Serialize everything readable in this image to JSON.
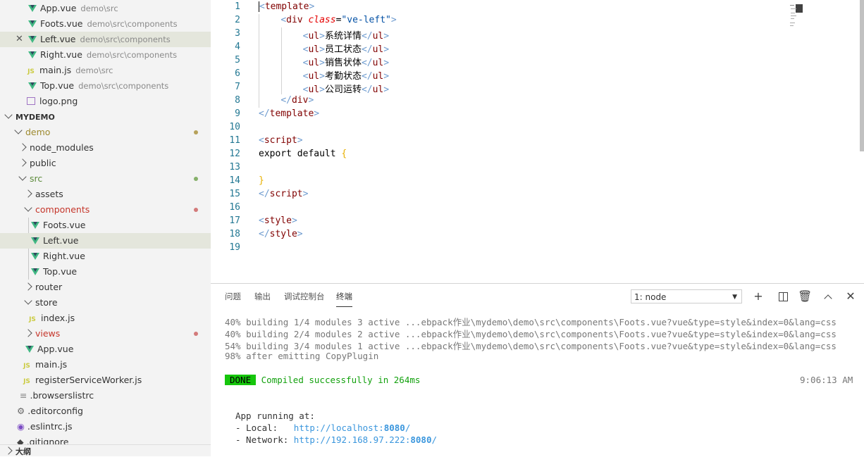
{
  "open_editors": [
    {
      "name": "App.vue",
      "path": "demo\\src",
      "type": "vue"
    },
    {
      "name": "Foots.vue",
      "path": "demo\\src\\components",
      "type": "vue"
    },
    {
      "name": "Left.vue",
      "path": "demo\\src\\components",
      "type": "vue",
      "selected": true
    },
    {
      "name": "Right.vue",
      "path": "demo\\src\\components",
      "type": "vue"
    },
    {
      "name": "main.js",
      "path": "demo\\src",
      "type": "js"
    },
    {
      "name": "Top.vue",
      "path": "demo\\src\\components",
      "type": "vue"
    },
    {
      "name": "logo.png",
      "path": "",
      "type": "img"
    }
  ],
  "explorer": {
    "section_title": "MYDEMO",
    "items": {
      "demo": "demo",
      "node_modules": "node_modules",
      "public": "public",
      "src": "src",
      "assets": "assets",
      "components": "components",
      "foots": "Foots.vue",
      "left": "Left.vue",
      "right": "Right.vue",
      "top": "Top.vue",
      "router": "router",
      "store": "store",
      "index": "index.js",
      "views": "views",
      "app": "App.vue",
      "main": "main.js",
      "rsw": "registerServiceWorker.js",
      "browserslist": ".browserslistrc",
      "editorconfig": ".editorconfig",
      "eslintrc": ".eslintrc.js",
      "gitignore": ".gitignore"
    },
    "outline_title": "大纲",
    "colors": {
      "modified": "#c5352a",
      "yellow_dot": "#b6a15a",
      "green_dot": "#86b06a"
    }
  },
  "editor": {
    "line_numbers": [
      "1",
      "2",
      "3",
      "4",
      "5",
      "6",
      "7",
      "8",
      "9",
      "10",
      "11",
      "12",
      "13",
      "14",
      "15",
      "16",
      "17",
      "18",
      "19"
    ],
    "items": [
      "系统详情",
      "员工状态",
      "销售状体",
      "考勤状态",
      "公司运转"
    ],
    "class_value": "\"ve-left\"",
    "export_text": "export default"
  },
  "panel": {
    "tabs": [
      "问题",
      "输出",
      "调试控制台",
      "终端"
    ],
    "active_tab": "终端",
    "terminal_select": "1: node",
    "log_lines": [
      "40% building 1/4 modules 3 active ...ebpack作业\\mydemo\\demo\\src\\components\\Foots.vue?vue&type=style&index=0&lang=css",
      "40% building 2/4 modules 2 active ...ebpack作业\\mydemo\\demo\\src\\components\\Foots.vue?vue&type=style&index=0&lang=css",
      "54% building 3/4 modules 1 active ...ebpack作业\\mydemo\\demo\\src\\components\\Foots.vue?vue&type=style&index=0&lang=css",
      "98% after emitting CopyPlugin"
    ],
    "done_badge": "DONE",
    "compiled_msg": "Compiled successfully in 264ms",
    "time": "9:06:13 AM",
    "app_running": "App running at:",
    "local_label": "- Local:   ",
    "local_url": "http://localhost:",
    "local_port": "8080",
    "network_label": "- Network: ",
    "network_url": "http://192.168.97.222:",
    "network_port": "8080",
    "url_suffix": "/"
  }
}
